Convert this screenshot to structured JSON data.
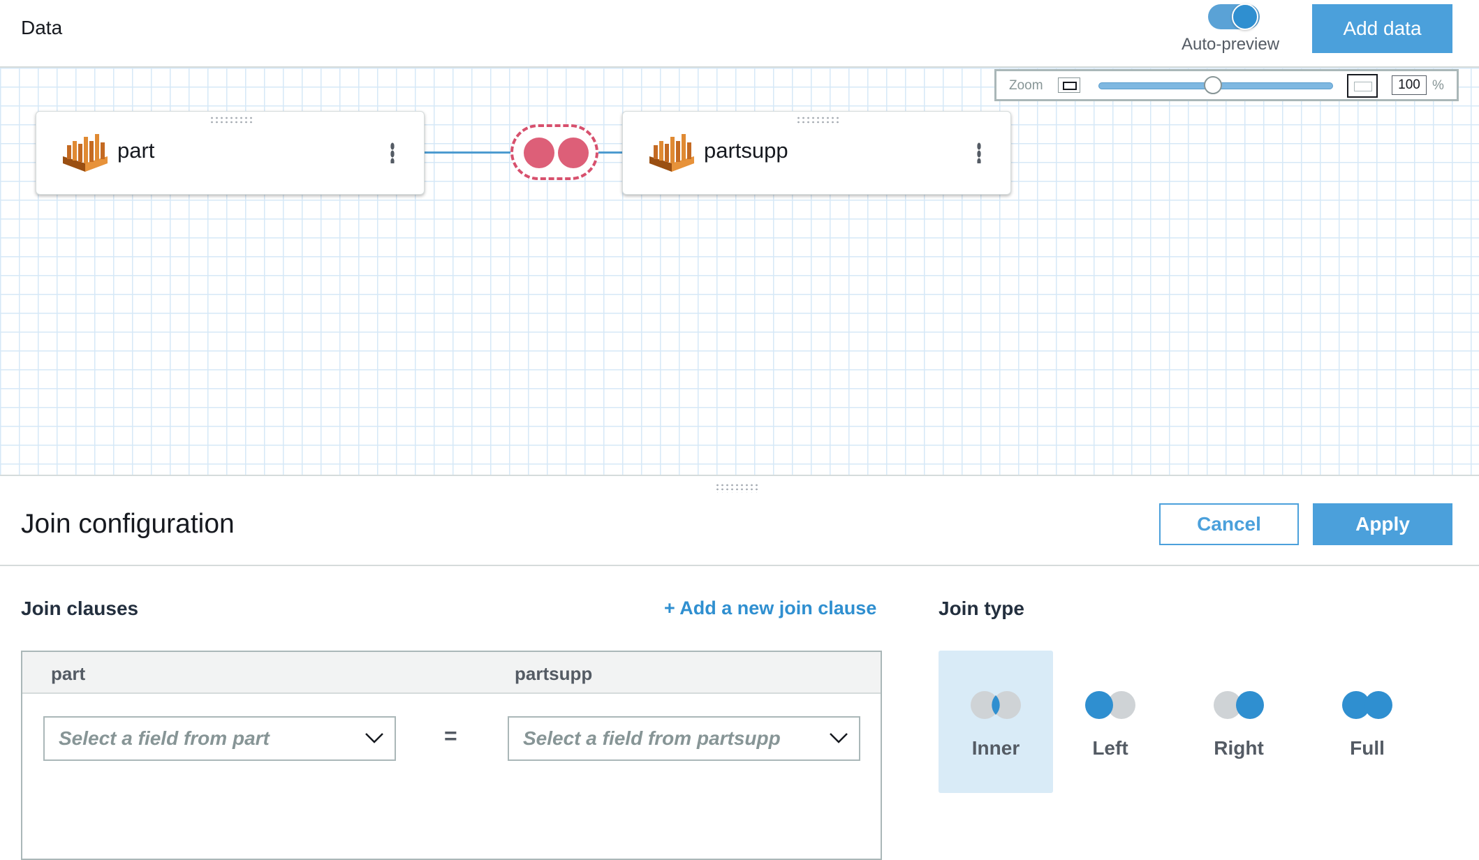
{
  "header": {
    "title": "Data",
    "auto_preview_label": "Auto-preview",
    "auto_preview_enabled": true,
    "add_data_label": "Add data"
  },
  "zoom": {
    "label": "Zoom",
    "value": "100",
    "unit": "%",
    "slider_level": 0.5
  },
  "canvas": {
    "nodes": [
      {
        "label": "part",
        "icon": "redshift-table-icon"
      },
      {
        "label": "partsupp",
        "icon": "redshift-table-icon"
      }
    ],
    "join_icon": "join-icon"
  },
  "join_config": {
    "title": "Join configuration",
    "cancel_label": "Cancel",
    "apply_label": "Apply",
    "clauses_heading": "Join clauses",
    "add_clause_label": "+ Add a new join clause",
    "left_column": "part",
    "right_column": "partsupp",
    "left_placeholder": "Select a field from part",
    "right_placeholder": "Select a field from partsupp",
    "operator": "=",
    "join_type_heading": "Join type",
    "join_types": [
      {
        "label": "Inner",
        "selected": true
      },
      {
        "label": "Left",
        "selected": false
      },
      {
        "label": "Right",
        "selected": false
      },
      {
        "label": "Full",
        "selected": false
      }
    ]
  },
  "colors": {
    "accent": "#4ba0db",
    "join_red": "#dd5f78",
    "selected_bg": "#d9ebf7",
    "grid": "#d6e8f7"
  }
}
